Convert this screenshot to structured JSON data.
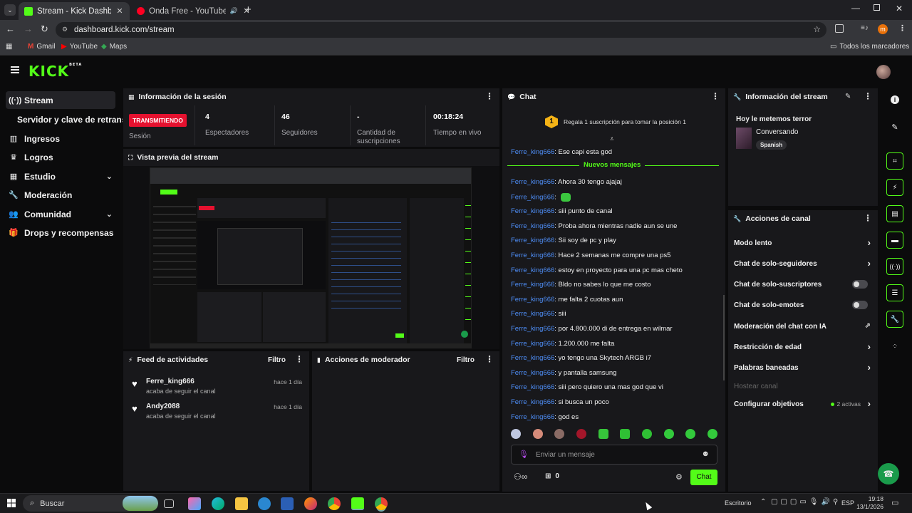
{
  "browser": {
    "tabs": [
      {
        "title": "Stream - Kick Dashboard",
        "active": true
      },
      {
        "title": "Onda Free - YouTube Music",
        "active": false
      }
    ],
    "url": "dashboard.kick.com/stream",
    "bookmarks": [
      "Gmail",
      "YouTube",
      "Maps"
    ],
    "all_bookmarks": "Todos los marcadores",
    "profile_initial": "m"
  },
  "kick": {
    "logo": "KICK",
    "logo_sup": "BETA"
  },
  "sidebar": {
    "items": [
      {
        "label": "Stream",
        "icon": "broadcast-icon"
      },
      {
        "label": "Servidor y clave de retransmisión",
        "icon": ""
      },
      {
        "label": "Ingresos",
        "icon": "bar-chart-icon"
      },
      {
        "label": "Logros",
        "icon": "trophy-icon"
      },
      {
        "label": "Estudio",
        "icon": "grid-icon"
      },
      {
        "label": "Moderación",
        "icon": "wrench-icon"
      },
      {
        "label": "Comunidad",
        "icon": "people-icon"
      },
      {
        "label": "Drops y recompensas",
        "icon": "gift-icon"
      }
    ]
  },
  "session": {
    "title": "Información de la sesión",
    "live_badge": "TRANSMITIENDO",
    "stats": [
      {
        "value": "",
        "label": "Sesión"
      },
      {
        "value": "4",
        "label": "Espectadores"
      },
      {
        "value": "46",
        "label": "Seguidores"
      },
      {
        "value": "-",
        "label": "Cantidad de suscripciones"
      },
      {
        "value": "00:18:24",
        "label": "Tiempo en vivo"
      }
    ]
  },
  "preview": {
    "title": "Vista previa del stream"
  },
  "feed": {
    "title": "Feed de actividades",
    "filter": "Filtro",
    "items": [
      {
        "user": "Ferre_king666",
        "action": "acaba de seguir el canal",
        "time": "hace 1 día"
      },
      {
        "user": "Andy2088",
        "action": "acaba de seguir el canal",
        "time": "hace 1 día"
      }
    ]
  },
  "modactions": {
    "title": "Acciones de moderador",
    "filter": "Filtro"
  },
  "chat": {
    "title": "Chat",
    "sub_rank": "1",
    "sub_prompt": "Regala 1 suscripción para tomar la posición 1",
    "first_line": {
      "user": "Ferre_king666",
      "text": ": Ese capi esta god"
    },
    "new_messages": "Nuevos mensajes",
    "messages": [
      {
        "user": "Ferre_king666",
        "text": ": Ahora 30 tengo ajajaj"
      },
      {
        "user": "Ferre_king666",
        "text": ":"
      },
      {
        "user": "Ferre_king666",
        "text": ": siii punto de canal"
      },
      {
        "user": "Ferre_king666",
        "text": ": Proba ahora mientras nadie aun se une"
      },
      {
        "user": "Ferre_king666",
        "text": ": Sii soy de pc y play"
      },
      {
        "user": "Ferre_king666",
        "text": ": Hace 2 semanas me compre una ps5"
      },
      {
        "user": "Ferre_king666",
        "text": ": estoy en proyecto para una pc mas cheto"
      },
      {
        "user": "Ferre_king666",
        "text": ": Bldo no sabes lo que me costo"
      },
      {
        "user": "Ferre_king666",
        "text": ": me falta 2 cuotas aun"
      },
      {
        "user": "Ferre_king666",
        "text": ": siii"
      },
      {
        "user": "Ferre_king666",
        "text": ": por 4.800.000 di de entrega en wilmar"
      },
      {
        "user": "Ferre_king666",
        "text": ": 1.200.000 me falta"
      },
      {
        "user": "Ferre_king666",
        "text": ": yo tengo una Skytech ARGB i7"
      },
      {
        "user": "Ferre_king666",
        "text": ": y pantalla samsung"
      },
      {
        "user": "Ferre_king666",
        "text": ": siii pero quiero una mas god que vi"
      },
      {
        "user": "Ferre_king666",
        "text": ": si busca un poco"
      },
      {
        "user": "Ferre_king666",
        "text": ": god es"
      }
    ],
    "input_placeholder": "Enviar un mensaje",
    "points": "0",
    "send": "Chat"
  },
  "streaminfo": {
    "title": "Información del stream",
    "stream_title": "Hoy le metemos terror",
    "category": "Conversando",
    "language": "Spanish"
  },
  "channel_actions": {
    "title": "Acciones de canal",
    "items": [
      {
        "label": "Modo lento",
        "control": "chevron"
      },
      {
        "label": "Chat de solo-seguidores",
        "control": "chevron"
      },
      {
        "label": "Chat de solo-suscriptores",
        "control": "toggle"
      },
      {
        "label": "Chat de solo-emotes",
        "control": "toggle"
      },
      {
        "label": "Moderación del chat con IA",
        "control": "external"
      },
      {
        "label": "Restricción de edad",
        "control": "chevron"
      },
      {
        "label": "Palabras baneadas",
        "control": "chevron"
      },
      {
        "label": "Hostear canal",
        "control": "disabled"
      },
      {
        "label": "Configurar objetivos",
        "control": "chevron"
      }
    ],
    "goals_active": "2 activas"
  },
  "taskbar": {
    "search": "Buscar",
    "desktop": "Escritorio",
    "lang": "ESP",
    "time": "19:18",
    "date": "13/1/2026"
  },
  "colors": {
    "kick_green": "#53fc18",
    "live_red": "#e5112f",
    "username_blue": "#4e8ef7"
  }
}
